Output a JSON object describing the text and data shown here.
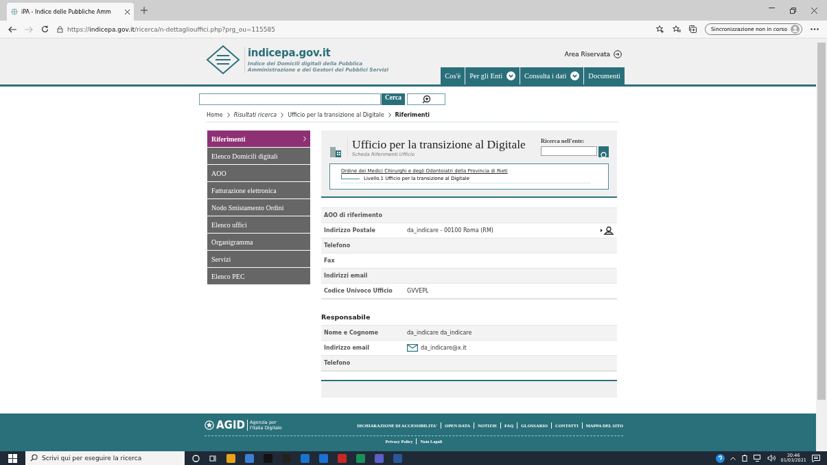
{
  "browser": {
    "tab_title": "iPA - Indice delle Pubbliche Amm",
    "url_scheme": "https://",
    "url_host": "indicepa.gov.it",
    "url_path": "/ricerca/n-dettagliouffici.php?prg_ou=115585",
    "sync_label": "Sincronizzazione non in corso"
  },
  "header": {
    "site_name": "indicepa.gov.it",
    "subtitle_1": "Indice dei Domicili digitali della Pubblica",
    "subtitle_2": "Amministrazione e dei Gestori dei Pubblici Servizi",
    "area_riservata": "Area Riservata",
    "nav": [
      {
        "label": "Cos'è",
        "dropdown": false
      },
      {
        "label": "Per gli Enti",
        "dropdown": true
      },
      {
        "label": "Consulta i dati",
        "dropdown": true
      },
      {
        "label": "Documenti",
        "dropdown": false
      }
    ]
  },
  "search": {
    "button": "Cerca"
  },
  "breadcrumb": [
    {
      "label": "Home",
      "kind": "link"
    },
    {
      "label": "Risultati ricerca",
      "kind": "italic"
    },
    {
      "label": "Ufficio per la transizione al Digitale",
      "kind": "link"
    },
    {
      "label": "Riferimenti",
      "kind": "current"
    }
  ],
  "sidebar": [
    {
      "label": "Riferimenti",
      "selected": true
    },
    {
      "label": "Elenco Domicili digitali",
      "selected": false
    },
    {
      "label": "AOO",
      "selected": false
    },
    {
      "label": "Fatturazione elettronica",
      "selected": false
    },
    {
      "label": "Nodo Smistamento Ordini",
      "selected": false
    },
    {
      "label": "Elenco uffici",
      "selected": false
    },
    {
      "label": "Organigramma",
      "selected": false
    },
    {
      "label": "Servizi",
      "selected": false
    },
    {
      "label": "Elenco PEC",
      "selected": false
    }
  ],
  "card": {
    "title": "Ufficio per la transizione al Digitale",
    "subtitle": "Scheda Riferimenti Ufficio",
    "search_label": "Ricerca nell'ente:",
    "org_link": "Ordine dei Medici Chirurghi e degli Odontoiatri della Provincia di Rieti",
    "level_text": "Livello.1 Ufficio per la transizione al Digitale"
  },
  "details": [
    {
      "label": "AOO di riferimento",
      "kind": "text"
    },
    {
      "label": "Indirizzo Postale",
      "value": "da_indicare - 00100 Roma (RM)",
      "kind": "address"
    },
    {
      "label": "Telefono",
      "kind": "text"
    },
    {
      "label": "Fax",
      "kind": "text"
    },
    {
      "label": "Indirizzi email",
      "kind": "text"
    },
    {
      "label": "Codice Univoco Ufficio",
      "value": "GVVEPL",
      "kind": "text"
    }
  ],
  "responsabile": {
    "heading": "Responsabile",
    "rows": [
      {
        "label": "Nome e Cognome",
        "value": "da_indicare da_indicare",
        "kind": "text"
      },
      {
        "label": "Indirizzo email",
        "value": "da_indicare@x.it",
        "kind": "email"
      },
      {
        "label": "Telefono",
        "kind": "text"
      }
    ]
  },
  "footer": {
    "logo": "AGID",
    "agency_1": "Agenzia per",
    "agency_2": "l'Italia Digitale",
    "links": [
      "DICHIARAZIONE DI ACCESSIBILITA'",
      "OPEN DATA",
      "NOTIZIE",
      "FAQ",
      "GLOSSARIO",
      "CONTATTI",
      "MAPPA DEL SITO"
    ],
    "bottom_links": [
      "Privacy Policy",
      "Note Legali"
    ]
  },
  "taskbar": {
    "search_placeholder": "Scrivi qui per eseguire la ricerca",
    "time": "20:46",
    "date": "01/03/2021"
  }
}
